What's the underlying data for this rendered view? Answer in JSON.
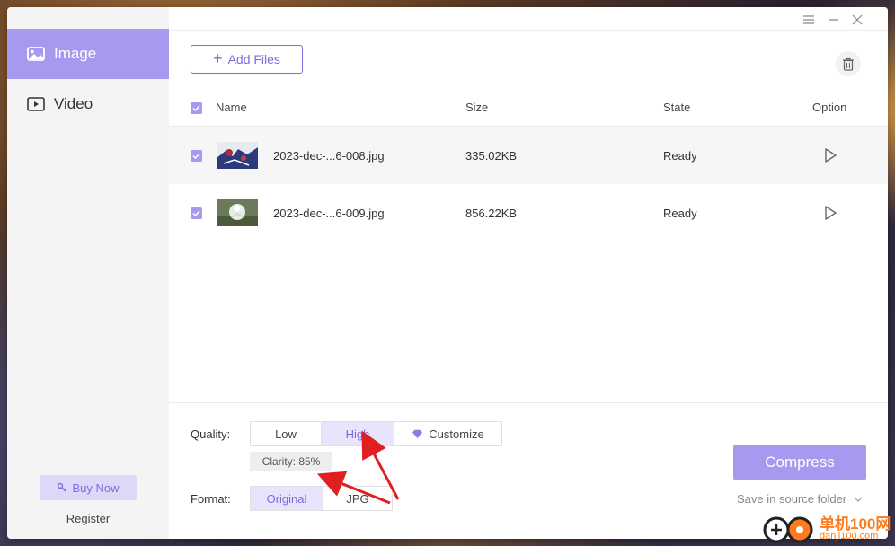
{
  "sidebar": {
    "items": [
      {
        "label": "Image",
        "icon": "image-icon",
        "active": true
      },
      {
        "label": "Video",
        "icon": "video-icon",
        "active": false
      }
    ],
    "buy_label": "Buy Now",
    "register_label": "Register"
  },
  "toolbar": {
    "add_files_label": "Add Files"
  },
  "table": {
    "headers": {
      "name": "Name",
      "size": "Size",
      "state": "State",
      "option": "Option"
    },
    "rows": [
      {
        "name": "2023-dec-...6-008.jpg",
        "size": "335.02KB",
        "state": "Ready"
      },
      {
        "name": "2023-dec-...6-009.jpg",
        "size": "856.22KB",
        "state": "Ready"
      }
    ]
  },
  "settings": {
    "quality_label": "Quality:",
    "quality_options": [
      "Low",
      "High",
      "Customize"
    ],
    "quality_selected": "High",
    "clarity": "Clarity: 85%",
    "format_label": "Format:",
    "format_options": [
      "Original",
      "JPG"
    ],
    "format_selected": "Original"
  },
  "actions": {
    "compress_label": "Compress",
    "save_location": "Save in source folder"
  },
  "watermark": {
    "cn": "单机100网",
    "url": "danji100.com"
  },
  "colors": {
    "accent": "#a599f0",
    "accent_text": "#7a6de0",
    "arrow": "#e02020"
  }
}
